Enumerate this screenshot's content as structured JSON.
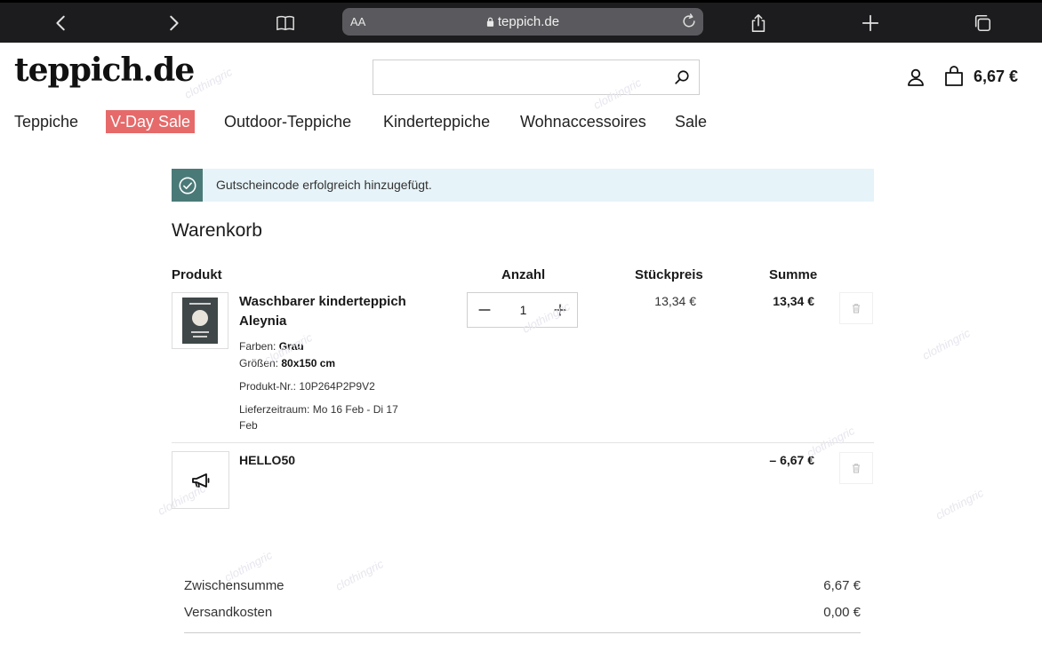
{
  "browser": {
    "address_aa": "AA",
    "url": "teppich.de"
  },
  "header": {
    "logo": "teppich.de",
    "search_placeholder": "",
    "cart_total": "6,67 €"
  },
  "nav": {
    "items": [
      {
        "label": "Teppiche"
      },
      {
        "label": "V-Day Sale"
      },
      {
        "label": "Outdoor-Teppiche"
      },
      {
        "label": "Kinderteppiche"
      },
      {
        "label": "Wohnaccessoires"
      },
      {
        "label": "Sale"
      }
    ]
  },
  "notice": {
    "message": "Gutscheincode erfolgreich hinzugefügt."
  },
  "cart": {
    "title": "Warenkorb",
    "columns": {
      "product": "Produkt",
      "quantity": "Anzahl",
      "unit_price": "Stückpreis",
      "sum": "Summe"
    },
    "item": {
      "name": "Waschbarer kinderteppich Aleynia",
      "color_label": "Farben:",
      "color": "Grau",
      "size_label": "Größen:",
      "size": "80x150 cm",
      "sku": "Produkt-Nr.: 10P264P2P9V2",
      "delivery": "Lieferzeitraum: Mo 16 Feb - Di 17 Feb",
      "quantity": "1",
      "unit_price": "13,34 €",
      "sum": "13,34 €"
    },
    "coupon": {
      "code": "HELLO50",
      "discount": "– 6,67 €"
    }
  },
  "totals": {
    "subtotal_label": "Zwischensumme",
    "subtotal": "6,67 €",
    "shipping_label": "Versandkosten",
    "shipping": "0,00 €"
  },
  "watermark": "clothingric",
  "colors": {
    "sale_badge": "#e66a6a",
    "notice_bg": "#e6f3f8",
    "notice_accent": "#4a7a78"
  }
}
